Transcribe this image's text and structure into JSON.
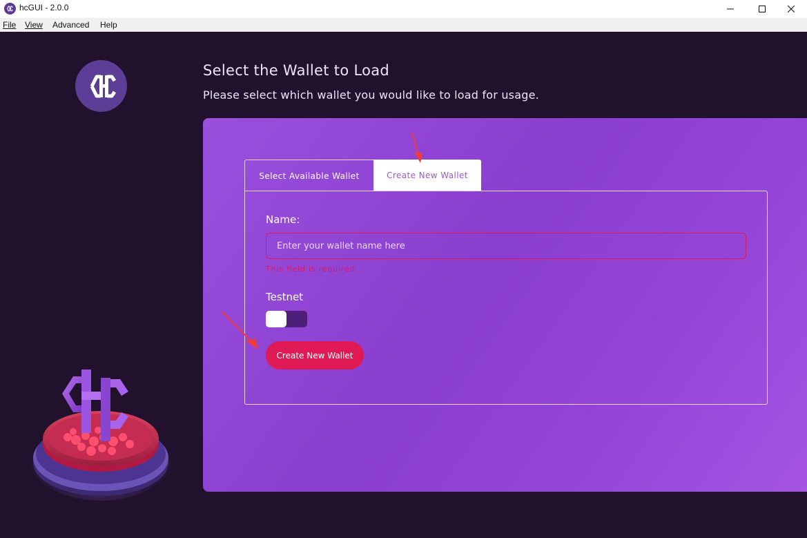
{
  "window": {
    "title": "hcGUI - 2.0.0",
    "icon": "hc-logo-icon"
  },
  "menu": {
    "file": "File",
    "view": "View",
    "advanced": "Advanced",
    "help": "Help"
  },
  "header": {
    "title": "Select the Wallet to Load",
    "subtitle": "Please select which wallet you would like to load for usage."
  },
  "tabs": {
    "available": "Select Available Wallet",
    "create": "Create New Wallet",
    "active": "create"
  },
  "form": {
    "name_label": "Name:",
    "name_value": "",
    "name_placeholder": "Enter your wallet name here",
    "name_error": "This field is required",
    "testnet_label": "Testnet",
    "testnet_enabled": false,
    "submit_label": "Create New Wallet"
  },
  "colors": {
    "background": "#21112d",
    "panel": "#9046d4",
    "accent": "#e01a55",
    "logo": "#5c3e96"
  }
}
